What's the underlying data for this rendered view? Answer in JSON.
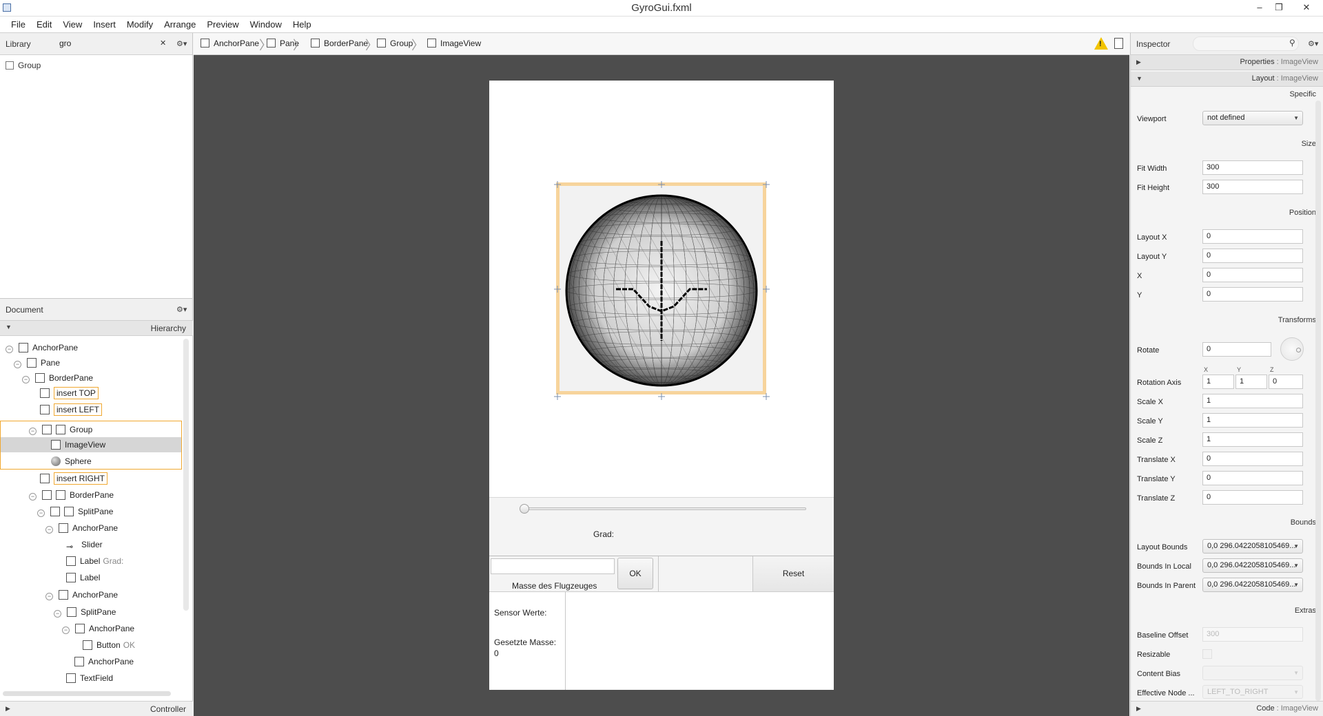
{
  "window": {
    "title": "GyroGui.fxml",
    "minimize": "–",
    "restore": "❐",
    "close": "✕"
  },
  "menu": [
    "File",
    "Edit",
    "View",
    "Insert",
    "Modify",
    "Arrange",
    "Preview",
    "Window",
    "Help"
  ],
  "library": {
    "title": "Library",
    "search_value": "gro",
    "clear": "✕",
    "gear": "⚙▾",
    "items": [
      "Group"
    ]
  },
  "document": {
    "title": "Document",
    "gear": "⚙▾",
    "hierarchy_label": "Hierarchy",
    "controller_label": "Controller",
    "tree": [
      {
        "label": "AnchorPane",
        "sub": ""
      },
      {
        "label": "Pane",
        "sub": ""
      },
      {
        "label": "BorderPane",
        "sub": ""
      },
      {
        "label": "insert TOP",
        "sub": ""
      },
      {
        "label": "insert LEFT",
        "sub": ""
      },
      {
        "label": "Group",
        "sub": ""
      },
      {
        "label": "ImageView",
        "sub": ""
      },
      {
        "label": "Sphere",
        "sub": ""
      },
      {
        "label": "insert RIGHT",
        "sub": ""
      },
      {
        "label": "BorderPane",
        "sub": ""
      },
      {
        "label": "SplitPane",
        "sub": ""
      },
      {
        "label": "AnchorPane",
        "sub": ""
      },
      {
        "label": "Slider",
        "sub": ""
      },
      {
        "label": "Label",
        "sub": "Grad:"
      },
      {
        "label": "Label",
        "sub": ""
      },
      {
        "label": "AnchorPane",
        "sub": ""
      },
      {
        "label": "SplitPane",
        "sub": ""
      },
      {
        "label": "AnchorPane",
        "sub": ""
      },
      {
        "label": "Button",
        "sub": "OK"
      },
      {
        "label": "AnchorPane",
        "sub": ""
      },
      {
        "label": "TextField",
        "sub": ""
      }
    ]
  },
  "breadcrumb": [
    "AnchorPane",
    "Pane",
    "BorderPane",
    "Group",
    "ImageView"
  ],
  "warning_icon": "!",
  "stage": {
    "grad_label": "Grad:",
    "slider_value": 0,
    "mass_input_value": "",
    "mass_label": "Masse des Flugzeuges",
    "ok_label": "OK",
    "reset_label": "Reset",
    "sensor_label": "Sensor Werte:",
    "mass_set_label": "Gesetzte Masse:",
    "mass_set_value": "0"
  },
  "inspector": {
    "title": "Inspector",
    "search_icon": "⚲",
    "gear": "⚙▾",
    "properties_section": {
      "label": "Properties",
      "sub": " : ImageView"
    },
    "layout_section": {
      "label": "Layout",
      "sub": " : ImageView"
    },
    "code_section": {
      "label": "Code",
      "sub": " : ImageView"
    },
    "groups": {
      "specific": "Specific",
      "size": "Size",
      "position": "Position",
      "transforms": "Transforms",
      "bounds": "Bounds",
      "extras": "Extras"
    },
    "viewport": {
      "label": "Viewport",
      "value": "not defined"
    },
    "fit_width": {
      "label": "Fit Width",
      "value": "300"
    },
    "fit_height": {
      "label": "Fit Height",
      "value": "300"
    },
    "layout_x": {
      "label": "Layout X",
      "value": "0"
    },
    "layout_y": {
      "label": "Layout Y",
      "value": "0"
    },
    "x": {
      "label": "X",
      "value": "0"
    },
    "y": {
      "label": "Y",
      "value": "0"
    },
    "rotate": {
      "label": "Rotate",
      "value": "0"
    },
    "rotation_axis": {
      "label": "Rotation Axis",
      "hx": "X",
      "hy": "Y",
      "hz": "Z",
      "x": "1",
      "y": "1",
      "z": "0"
    },
    "scale_x": {
      "label": "Scale X",
      "value": "1"
    },
    "scale_y": {
      "label": "Scale Y",
      "value": "1"
    },
    "scale_z": {
      "label": "Scale Z",
      "value": "1"
    },
    "translate_x": {
      "label": "Translate X",
      "value": "0"
    },
    "translate_y": {
      "label": "Translate Y",
      "value": "0"
    },
    "translate_z": {
      "label": "Translate Z",
      "value": "0"
    },
    "layout_bounds": {
      "label": "Layout Bounds",
      "value": "0,0  296.0422058105469..."
    },
    "bounds_local": {
      "label": "Bounds In Local",
      "value": "0,0  296.0422058105469..."
    },
    "bounds_parent": {
      "label": "Bounds In Parent",
      "value": "0,0  296.0422058105469..."
    },
    "baseline_offset": {
      "label": "Baseline Offset",
      "value": "300"
    },
    "resizable": {
      "label": "Resizable"
    },
    "content_bias": {
      "label": "Content Bias",
      "value": ""
    },
    "effective_node": {
      "label": "Effective Node ...",
      "value": "LEFT_TO_RIGHT"
    }
  }
}
